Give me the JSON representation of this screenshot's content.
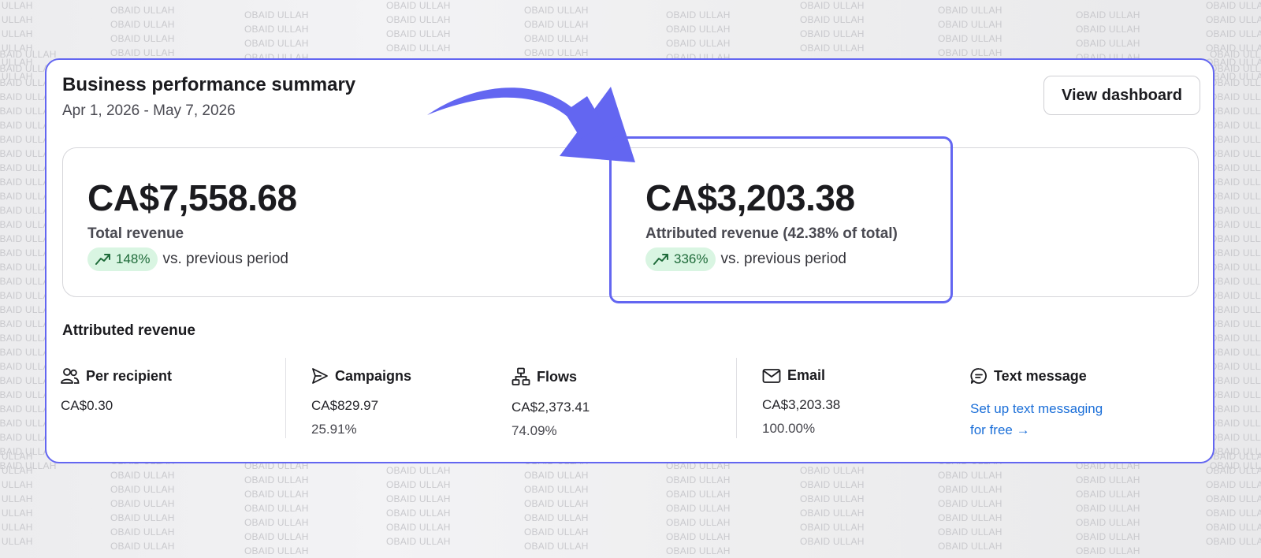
{
  "watermark": "OBAID ULLAH",
  "card": {
    "title": "Business performance summary",
    "date_range": "Apr 1, 2026 - May 7, 2026",
    "view_dashboard_label": "View dashboard"
  },
  "metrics": {
    "total": {
      "amount": "CA$7,558.68",
      "label": "Total revenue",
      "change": "148%",
      "comparison": "vs. previous period"
    },
    "attributed": {
      "amount": "CA$3,203.38",
      "label": "Attributed revenue (42.38% of total)",
      "change": "336%",
      "comparison": "vs. previous period"
    }
  },
  "breakdown": {
    "title": "Attributed revenue",
    "columns": [
      {
        "icon": "people-icon",
        "label": "Per recipient",
        "value": "CA$0.30",
        "percent": ""
      },
      {
        "icon": "send-icon",
        "label": "Campaigns",
        "value": "CA$829.97",
        "percent": "25.91%"
      },
      {
        "icon": "flow-icon",
        "label": "Flows",
        "value": "CA$2,373.41",
        "percent": "74.09%"
      },
      {
        "icon": "mail-icon",
        "label": "Email",
        "value": "CA$3,203.38",
        "percent": "100.00%"
      },
      {
        "icon": "chat-icon",
        "label": "Text message",
        "link_line1": "Set up text messaging",
        "link_line2": "for free →"
      }
    ]
  },
  "colors": {
    "accent": "#6366f1",
    "pill_bg": "#d9f5e2",
    "pill_text": "#1f6b3a",
    "link": "#1a6ed8"
  }
}
